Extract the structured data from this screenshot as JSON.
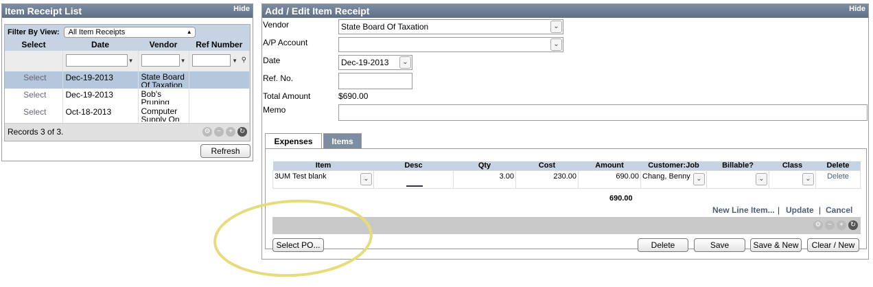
{
  "list_panel": {
    "title": "Item Receipt List",
    "hide_label": "Hide",
    "filter_label": "Filter By View:",
    "filter_value": "All Item Receipts",
    "columns": [
      "Select",
      "Date",
      "Vendor",
      "Ref Number"
    ],
    "rows": [
      {
        "select": "Select",
        "date": "Dec-19-2013",
        "vendor": "State Board Of Taxation",
        "ref": ""
      },
      {
        "select": "Select",
        "date": "Dec-19-2013",
        "vendor": "Bob's Pruning",
        "ref": ""
      },
      {
        "select": "Select",
        "date": "Oct-18-2013",
        "vendor": "Computer Supply On",
        "ref": ""
      }
    ],
    "records_text": "Records 3 of 3.",
    "refresh_label": "Refresh"
  },
  "form_panel": {
    "title": "Add / Edit Item Receipt",
    "hide_label": "Hide",
    "vendor_label": "Vendor",
    "vendor_value": "State Board Of Taxation",
    "ap_label": "A/P Account",
    "ap_value": "",
    "date_label": "Date",
    "date_value": "Dec-19-2013",
    "ref_label": "Ref. No.",
    "ref_value": "",
    "total_label": "Total Amount",
    "total_value": "$690.00",
    "memo_label": "Memo",
    "memo_value": ""
  },
  "tabs": {
    "expenses": "Expenses",
    "items": "Items"
  },
  "items_grid": {
    "columns": [
      "Item",
      "Desc",
      "Qty",
      "Cost",
      "Amount",
      "Customer:Job",
      "Billable?",
      "Class",
      "Delete"
    ],
    "row": {
      "item": "3UM Test blank",
      "desc": "",
      "qty": "3.00",
      "cost": "230.00",
      "amount": "690.00",
      "customer_job": "Chang, Benny",
      "billable": "",
      "class": "",
      "delete": "Delete"
    },
    "total_amount": "690.00",
    "new_line_label": "New Line Item...",
    "update_label": "Update",
    "cancel_label": "Cancel",
    "separator": "|"
  },
  "buttons": {
    "select_po": "Select PO...",
    "delete": "Delete",
    "save": "Save",
    "save_new": "Save & New",
    "clear_new": "Clear / New"
  },
  "colors": {
    "header": "#6e7f93",
    "header_light": "#c6d3e2",
    "selected_row": "#b4c7dc",
    "highlight_ellipse": "#e6dc7a"
  }
}
